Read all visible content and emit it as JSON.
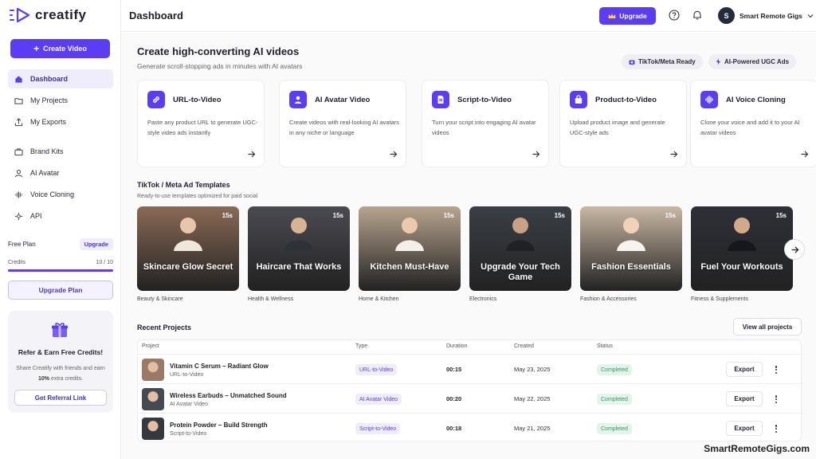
{
  "app": {
    "logo_text": "creatify",
    "brand_color": "#5b3df5"
  },
  "sidebar": {
    "create_button": "Create Video",
    "nav_primary": [
      {
        "label": "Dashboard",
        "icon": "home-icon",
        "active": true
      },
      {
        "label": "My Projects",
        "icon": "folder-icon"
      },
      {
        "label": "My Exports",
        "icon": "export-icon"
      }
    ],
    "nav_secondary": [
      {
        "label": "Brand Kits",
        "icon": "briefcase-icon"
      },
      {
        "label": "AI Avatar",
        "icon": "user-icon"
      },
      {
        "label": "Voice Cloning",
        "icon": "waveform-icon"
      },
      {
        "label": "API",
        "icon": "code-icon"
      }
    ],
    "plan_label": "Free Plan",
    "plan_upgrade": "Upgrade",
    "credits_label": "Credits",
    "credits_value": "10 / 10",
    "credits_fraction": 1.0,
    "upgrade_plan": "Upgrade Plan",
    "refer": {
      "title": "Refer & Earn Free Credits!",
      "text_before": "Share Creatify with friends and earn ",
      "text_bold": "10%",
      "text_after": " extra credits.",
      "button": "Get Referral Link"
    }
  },
  "header": {
    "title": "Dashboard",
    "upgrade": "Upgrade",
    "user_initial": "S",
    "user_name": "Smart Remote Gigs"
  },
  "hero": {
    "title": "Create high-converting AI videos",
    "subtitle": "Generate scroll-stopping ads in minutes with AI avatars",
    "pills": [
      "TikTok/Meta Ready",
      "AI-Powered UGC Ads"
    ]
  },
  "features": [
    {
      "title": "URL-to-Video",
      "desc": "Paste any product URL to generate UGC-style video ads instantly",
      "icon": "link-icon"
    },
    {
      "title": "AI Avatar Video",
      "desc": "Create videos with real-looking AI avatars in any niche or language",
      "icon": "avatar-icon"
    },
    {
      "title": "Script-to-Video",
      "desc": "Turn your script into engaging AI avatar videos",
      "icon": "document-icon"
    },
    {
      "title": "Product-to-Video",
      "desc": "Upload product image and generate UGC-style ads",
      "icon": "shopping-bag-icon"
    },
    {
      "title": "AI Voice Cloning",
      "desc": "Clone your voice and add it to your AI avatar videos",
      "icon": "waveform-icon"
    }
  ],
  "templates": {
    "title": "TikTok / Meta Ad Templates",
    "subtitle": "Ready-to-use templates optimized for paid social",
    "items": [
      {
        "caption": "Skincare Glow Secret",
        "duration": "15s",
        "category": "Beauty & Skincare",
        "bg": "#8a6a55"
      },
      {
        "caption": "Haircare That Works",
        "duration": "15s",
        "category": "Health & Wellness",
        "bg": "#4a4a52"
      },
      {
        "caption": "Kitchen Must-Have",
        "duration": "15s",
        "category": "Home & Kitchen",
        "bg": "#b8a48e"
      },
      {
        "caption": "Upgrade Your Tech Game",
        "duration": "15s",
        "category": "Electronics",
        "bg": "#3a3f46"
      },
      {
        "caption": "Fashion Essentials",
        "duration": "15s",
        "category": "Fashion & Accessories",
        "bg": "#c9b8a4"
      },
      {
        "caption": "Fuel Your Workouts",
        "duration": "15s",
        "category": "Fitness & Supplements",
        "bg": "#2e3038"
      }
    ]
  },
  "recent": {
    "title": "Recent Projects",
    "view_all": "View all projects",
    "columns": [
      "Project",
      "Type",
      "Duration",
      "Created",
      "Status"
    ],
    "rows": [
      {
        "name": "Vitamin C Serum – Radiant Glow",
        "type_sub": "URL-to-Video",
        "type": "URL-to-Video",
        "duration": "00:15",
        "created": "May 23, 2025",
        "status": "Completed",
        "action": "Export",
        "thumb": "#9a7a66"
      },
      {
        "name": "Wireless Earbuds – Unmatched Sound",
        "type_sub": "AI Avatar Video",
        "type": "AI Avatar Video",
        "duration": "00:20",
        "created": "May 22, 2025",
        "status": "Completed",
        "action": "Export",
        "thumb": "#444a52"
      },
      {
        "name": "Protein Powder – Build Strength",
        "type_sub": "Script-to-Video",
        "type": "Script-to-Video",
        "duration": "00:18",
        "created": "May 21, 2025",
        "status": "Completed",
        "action": "Export",
        "thumb": "#35383f"
      }
    ]
  },
  "watermark": "SmartRemoteGigs.com"
}
